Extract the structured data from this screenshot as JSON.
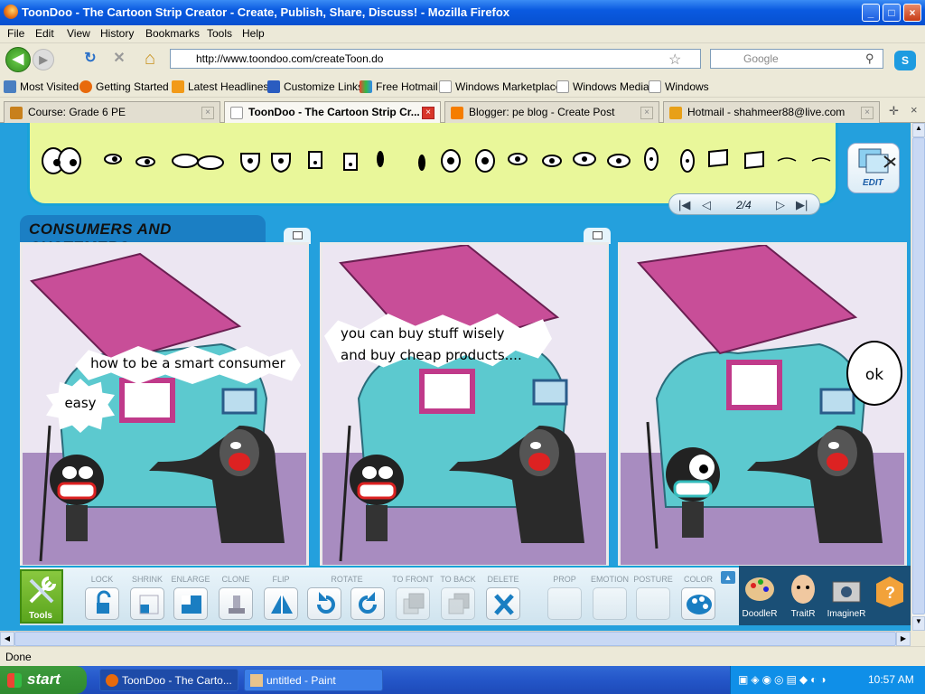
{
  "window": {
    "title": "ToonDoo - The Cartoon Strip Creator - Create, Publish, Share, Discuss! - Mozilla Firefox",
    "min": "_",
    "max": "□",
    "close": "×"
  },
  "menu": [
    "File",
    "Edit",
    "View",
    "History",
    "Bookmarks",
    "Tools",
    "Help"
  ],
  "nav": {
    "url": "http://www.toondoo.com/createToon.do",
    "search_placeholder": "Google",
    "back": "◀",
    "forward": "▶",
    "reload": "↻",
    "stop": "✕",
    "home": "⌂",
    "star": "☆"
  },
  "bookmarks": [
    "Most Visited",
    "Getting Started",
    "Latest Headlines",
    "Customize Links",
    "Free Hotmail",
    "Windows Marketplace",
    "Windows Media",
    "Windows"
  ],
  "tabs": [
    "Course: Grade 6 PE",
    "ToonDoo - The Cartoon Strip Cr...",
    "Blogger: pe blog - Create Post",
    "Hotmail - shahmeer88@live.com"
  ],
  "toondoo": {
    "edit_label": "EDIT",
    "pager": "2/4",
    "strip_title": "CONSUMERS AND CUSTEMERS",
    "panels": [
      {
        "bubbles": [
          "how to be a smart consumer",
          "easy"
        ]
      },
      {
        "bubbles": [
          "you can buy stuff wisely",
          "and buy cheap products...."
        ]
      },
      {
        "bubbles": [
          "ok"
        ]
      }
    ],
    "tools_label": "Tools",
    "tools": [
      "LOCK",
      "SHRINK",
      "ENLARGE",
      "CLONE",
      "FLIP",
      "ROTATE",
      "",
      "TO FRONT",
      "TO BACK",
      "DELETE"
    ],
    "tools2": [
      "PROP",
      "EMOTION",
      "POSTURE",
      "COLOR"
    ],
    "apps": [
      "DoodleR",
      "TraitR",
      "ImagineR"
    ]
  },
  "status": "Done",
  "taskbar": {
    "start": "start",
    "items": [
      "ToonDoo - The Carto...",
      "untitled - Paint"
    ],
    "clock": "10:57 AM"
  }
}
